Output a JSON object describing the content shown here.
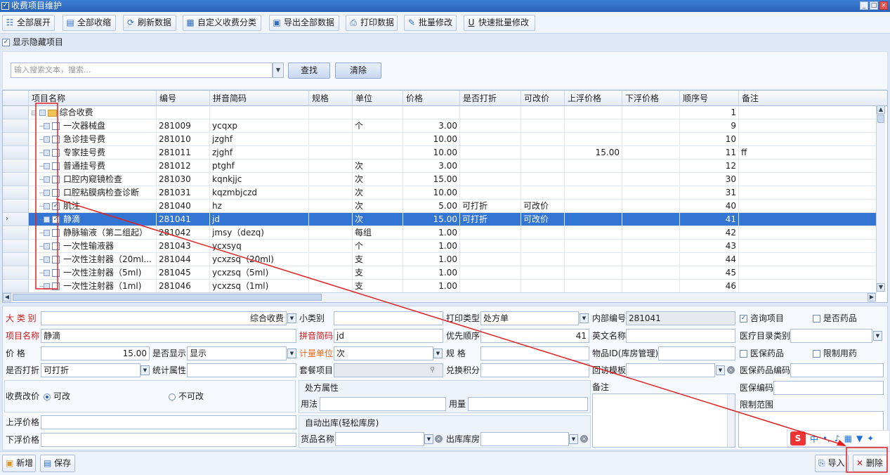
{
  "window": {
    "title": "收费项目维护",
    "controls": [
      "_",
      "□",
      "×"
    ]
  },
  "toolbar": [
    {
      "label": "全部展开",
      "icon": "expand-icon",
      "glyph": "☷"
    },
    {
      "label": "全部收缩",
      "icon": "collapse-icon",
      "glyph": "▤"
    },
    {
      "label": "刷新数据",
      "icon": "refresh-icon",
      "glyph": "⟳"
    },
    {
      "label": "自定义收费分类",
      "icon": "category-icon",
      "glyph": "▦"
    },
    {
      "label": "导出全部数据",
      "icon": "export-icon",
      "glyph": "▣"
    },
    {
      "label": "打印数据",
      "icon": "print-icon",
      "glyph": "⎙"
    },
    {
      "label": "批量修改",
      "icon": "batch-edit-icon",
      "glyph": "✎"
    },
    {
      "label": "快速批量修改",
      "icon": "quick-edit-icon",
      "glyph": "U"
    }
  ],
  "show_hidden": {
    "label": "显示隐藏项目",
    "checked": true
  },
  "search": {
    "placeholder": "输入搜索文本，搜索...",
    "find_label": "查找",
    "clear_label": "清除"
  },
  "grid": {
    "columns": [
      "项目名称",
      "编号",
      "拼音简码",
      "规格",
      "单位",
      "价格",
      "是否打折",
      "可改价",
      "上浮价格",
      "下浮价格",
      "顺序号",
      "备注"
    ],
    "rows": [
      {
        "name": "综合收费",
        "code": "",
        "py": "",
        "spec": "",
        "unit": "",
        "price": "",
        "discount": "",
        "editable": "",
        "up": "",
        "down": "",
        "order": "1",
        "note": "",
        "folder": true
      },
      {
        "name": "一次器械盘",
        "code": "281009",
        "py": "ycqxp",
        "spec": "",
        "unit": "个",
        "price": "3.00",
        "discount": "",
        "editable": "",
        "up": "",
        "down": "",
        "order": "9",
        "note": ""
      },
      {
        "name": "急诊挂号费",
        "code": "281010",
        "py": "jzghf",
        "spec": "",
        "unit": "",
        "price": "10.00",
        "discount": "",
        "editable": "",
        "up": "",
        "down": "",
        "order": "10",
        "note": ""
      },
      {
        "name": "专家挂号费",
        "code": "281011",
        "py": "zjghf",
        "spec": "",
        "unit": "",
        "price": "10.00",
        "discount": "",
        "editable": "",
        "up": "15.00",
        "down": "",
        "order": "11",
        "note": "ff"
      },
      {
        "name": "普通挂号费",
        "code": "281012",
        "py": "ptghf",
        "spec": "",
        "unit": "次",
        "price": "3.00",
        "discount": "",
        "editable": "",
        "up": "",
        "down": "",
        "order": "12",
        "note": ""
      },
      {
        "name": "口腔内窥镜检查",
        "code": "281030",
        "py": "kqnkjjc",
        "spec": "",
        "unit": "次",
        "price": "15.00",
        "discount": "",
        "editable": "",
        "up": "",
        "down": "",
        "order": "30",
        "note": ""
      },
      {
        "name": "口腔粘膜病检查诊断",
        "code": "281031",
        "py": "kqzmbjczd",
        "spec": "",
        "unit": " 次",
        "price": "10.00",
        "discount": "",
        "editable": "",
        "up": "",
        "down": "",
        "order": "31",
        "note": ""
      },
      {
        "name": "肌注",
        "code": "281040",
        "py": "hz",
        "spec": "",
        "unit": "次",
        "price": "5.00",
        "discount": "可打折",
        "editable": "可改价",
        "up": "",
        "down": "",
        "order": "40",
        "note": "",
        "checked": true
      },
      {
        "name": "静滴",
        "code": "281041",
        "py": "jd",
        "spec": "",
        "unit": "次",
        "price": "15.00",
        "discount": "可打折",
        "editable": "可改价",
        "up": "",
        "down": "",
        "order": "41",
        "note": "",
        "checked": true,
        "selected": true
      },
      {
        "name": "静脉输液（第二组起）",
        "code": "281042",
        "py": "jmsy（dezq)",
        "spec": "",
        "unit": "每组",
        "price": "1.00",
        "discount": "",
        "editable": "",
        "up": "",
        "down": "",
        "order": "42",
        "note": ""
      },
      {
        "name": "一次性输液器",
        "code": "281043",
        "py": "ycxsyq",
        "spec": "",
        "unit": "个",
        "price": "1.00",
        "discount": "",
        "editable": "",
        "up": "",
        "down": "",
        "order": "43",
        "note": ""
      },
      {
        "name": "一次性注射器（20ml...",
        "code": "281044",
        "py": "ycxzsq（20ml)",
        "spec": "",
        "unit": "支",
        "price": "1.00",
        "discount": "",
        "editable": "",
        "up": "",
        "down": "",
        "order": "44",
        "note": ""
      },
      {
        "name": "一次性注射器（5ml)",
        "code": "281045",
        "py": "ycxzsq（5ml)",
        "spec": "",
        "unit": "支",
        "price": "1.00",
        "discount": "",
        "editable": "",
        "up": "",
        "down": "",
        "order": "45",
        "note": ""
      },
      {
        "name": "一次性注射器（1ml)",
        "code": "281046",
        "py": "ycxzsq（1ml)",
        "spec": "",
        "unit": "支",
        "price": "1.00",
        "discount": "",
        "editable": "",
        "up": "",
        "down": "",
        "order": "46",
        "note": ""
      }
    ]
  },
  "form": {
    "big_category": {
      "label": "大 类 别",
      "value": "综合收费"
    },
    "small_category": {
      "label": "小类别",
      "value": ""
    },
    "print_type": {
      "label": "打印类型",
      "value": "处方单"
    },
    "internal_code": {
      "label": "内部编号",
      "value": "281041"
    },
    "consult_item": {
      "label": "咨询项目",
      "checked": true
    },
    "is_drug": {
      "label": "是否药品",
      "checked": false
    },
    "item_name": {
      "label": "项目名称",
      "value": "静滴"
    },
    "pinyin": {
      "label": "拼音简码",
      "value": "jd"
    },
    "priority": {
      "label": "优先顺序",
      "value": "41"
    },
    "english_name": {
      "label": "英文名称",
      "value": ""
    },
    "catalog_type": {
      "label": "医疗目录类别",
      "value": ""
    },
    "price": {
      "label": "价    格",
      "value": "15.00"
    },
    "show": {
      "label": "是否显示",
      "value": "显示"
    },
    "unit": {
      "label": "计量单位",
      "value": "次"
    },
    "spec": {
      "label": "规    格",
      "value": ""
    },
    "goods_id": {
      "label": "物品ID(库房管理)",
      "value": ""
    },
    "insurance_drug": {
      "label": "医保药品",
      "checked": false
    },
    "restricted": {
      "label": "限制用药",
      "checked": false
    },
    "discount": {
      "label": "是否打折",
      "value": "可打折"
    },
    "stat_attr": {
      "label": "统计属性",
      "value": ""
    },
    "package": {
      "label": "套餐项目",
      "value": ""
    },
    "points": {
      "label": "兑换积分",
      "value": ""
    },
    "followup": {
      "label": "回访模板",
      "value": ""
    },
    "ins_drug_code": {
      "label": "医保药品编码",
      "value": ""
    },
    "price_change": {
      "label": "收费改价",
      "opt_yes": "可改",
      "opt_no": "不可改"
    },
    "prescription": {
      "title": "处方属性",
      "usage": "用法",
      "dosage": "用量"
    },
    "remark": {
      "label": "备注"
    },
    "ins_code": {
      "label": "医保编码",
      "value": ""
    },
    "restrict_scope": {
      "label": "限制范围"
    },
    "up_price": {
      "label": "上浮价格",
      "value": ""
    },
    "down_price": {
      "label": "下浮价格",
      "value": ""
    },
    "auto_out": {
      "title": "自动出库(轻松库房)",
      "goods": "货品名称",
      "warehouse": "出库库房"
    }
  },
  "bottom": {
    "new": "新增",
    "save": "保存",
    "import": "导入",
    "delete": "删除"
  },
  "ime": {
    "logo": "S",
    "mode": "中"
  },
  "colors": {
    "selected_row": "#3375d2",
    "required_label": "#d01a1a",
    "annotation": "#e02020"
  }
}
